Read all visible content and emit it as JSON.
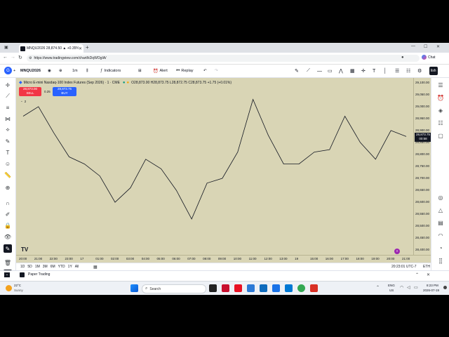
{
  "browser": {
    "tab_title": "MNQU2026 28,874.50 ▲ +0.35% ...",
    "url": "https://www.tradingview.com/chart/kDqWOgIA/",
    "chat_label": "Chat"
  },
  "toolbar": {
    "symbol": "MNQU2026",
    "interval": "1m",
    "indicators_label": "Indicators",
    "alert_label": "Alert",
    "replay_label": "Replay",
    "publish_label": "lish"
  },
  "legend": {
    "title": "Micro E-mini Nasdaq-100 Index Futures (Sep 2026) · 1 · CME",
    "ohlc": "O28,873.00 H28,873.75 L28,872.75 C28,873.75 +1.75 (+0.01%)",
    "sell_price": "28,873.00",
    "sell_label": "SELL",
    "spread": "0.25",
    "buy_price": "28,873.75",
    "buy_label": "BUY",
    "indicator_count": "2"
  },
  "yaxis": {
    "ticks": [
      "29,100.00",
      "29,050.00",
      "29,000.00",
      "28,950.00",
      "28,900.00",
      "28,850.00",
      "28,800.00",
      "28,750.00",
      "28,700.00",
      "28,650.00",
      "28,600.00",
      "28,550.00",
      "28,500.00",
      "28,450.00",
      "28,400.00"
    ],
    "current_price": "28,873.75",
    "countdown": "00:58"
  },
  "xaxis": {
    "ticks": [
      "20:00",
      "21:00",
      "22:00",
      "23:00",
      "17",
      "01:00",
      "02:00",
      "03:00",
      "04:00",
      "05:00",
      "06:00",
      "07:00",
      "08:00",
      "09:00",
      "10:00",
      "11:00",
      "12:00",
      "13:00",
      "19",
      "15:00",
      "16:00",
      "17:00",
      "18:00",
      "19:00",
      "20:00",
      "21:00"
    ]
  },
  "rangebar": {
    "ranges": [
      "1D",
      "5D",
      "1M",
      "3M",
      "6M",
      "YTD",
      "1Y",
      "All"
    ],
    "clock": "20:23:01 UTC-7",
    "session": "ETH"
  },
  "paper": {
    "label": "Paper Trading"
  },
  "taskbar": {
    "weather_temp": "22°C",
    "weather_text": "Sunny",
    "search_placeholder": "Search",
    "lang": "ENG",
    "region": "US",
    "time": "8:23 PM",
    "date": "2026-07-19"
  },
  "chart_data": {
    "type": "line",
    "title": "Micro E-mini Nasdaq-100 Index Futures (Sep 2026) · 1 · CME",
    "xlabel": "",
    "ylabel": "",
    "ylim": [
      28380,
      29120
    ],
    "x": [
      "20:00",
      "21:00",
      "22:00",
      "23:00",
      "17",
      "01:00",
      "02:00",
      "03:00",
      "04:00",
      "05:00",
      "06:00",
      "07:00",
      "08:00",
      "09:00",
      "10:00",
      "11:00",
      "12:00",
      "13:00",
      "19",
      "15:00",
      "16:00",
      "17:00",
      "18:00",
      "19:00",
      "20:00",
      "21:00"
    ],
    "series": [
      {
        "values": [
          28960,
          29000,
          28890,
          28790,
          28760,
          28710,
          28600,
          28660,
          28780,
          28740,
          28650,
          28530,
          28680,
          28700,
          28810,
          29030,
          28880,
          28760,
          28760,
          28810,
          28820,
          28960,
          28850,
          28780,
          28900,
          28875
        ]
      }
    ],
    "line_color": "#131722",
    "background_color": "#d9d5b5"
  }
}
